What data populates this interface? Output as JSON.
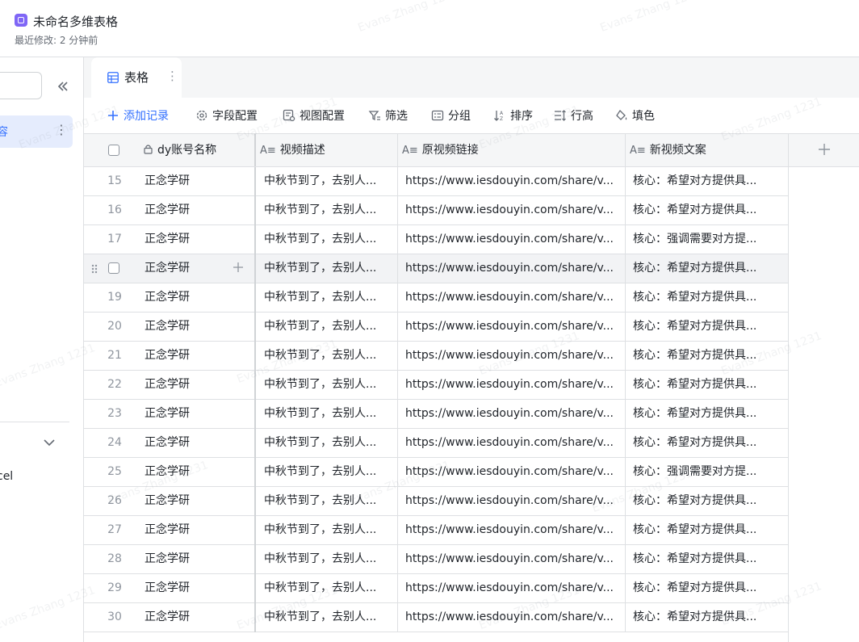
{
  "header": {
    "title": "未命名多维表格",
    "subtitle": "最近修改: 2 分钟前"
  },
  "sidebar": {
    "active_item_label": "容",
    "more_icon": "⋮",
    "section_item_label": "cel"
  },
  "tabs": [
    {
      "label": "表格",
      "more": "⋮"
    }
  ],
  "toolbar": {
    "add_record": "添加记录",
    "field_config": "字段配置",
    "view_config": "视图配置",
    "filter": "筛选",
    "group": "分组",
    "sort": "排序",
    "row_height": "行高",
    "fill_color": "填色"
  },
  "table": {
    "columns": [
      "dy账号名称",
      "视频描述",
      "原视频链接",
      "新视频文案"
    ],
    "rows": [
      {
        "num": "15",
        "account": "正念学研",
        "desc": "中秋节到了，去别人...",
        "link": "https://www.iesdouyin.com/share/v...",
        "copy": "核心：希望对方提供具..."
      },
      {
        "num": "16",
        "account": "正念学研",
        "desc": "中秋节到了，去别人...",
        "link": "https://www.iesdouyin.com/share/v...",
        "copy": "核心：希望对方提供具..."
      },
      {
        "num": "17",
        "account": "正念学研",
        "desc": "中秋节到了，去别人...",
        "link": "https://www.iesdouyin.com/share/v...",
        "copy": "核心：强调需要对方提..."
      },
      {
        "num": "",
        "account": "正念学研",
        "desc": "中秋节到了，去别人...",
        "link": "https://www.iesdouyin.com/share/v...",
        "copy": "核心：希望对方提供具..."
      },
      {
        "num": "19",
        "account": "正念学研",
        "desc": "中秋节到了，去别人...",
        "link": "https://www.iesdouyin.com/share/v...",
        "copy": "核心：希望对方提供具..."
      },
      {
        "num": "20",
        "account": "正念学研",
        "desc": "中秋节到了，去别人...",
        "link": "https://www.iesdouyin.com/share/v...",
        "copy": "核心：希望对方提供具..."
      },
      {
        "num": "21",
        "account": "正念学研",
        "desc": "中秋节到了，去别人...",
        "link": "https://www.iesdouyin.com/share/v...",
        "copy": "核心：希望对方提供具..."
      },
      {
        "num": "22",
        "account": "正念学研",
        "desc": "中秋节到了，去别人...",
        "link": "https://www.iesdouyin.com/share/v...",
        "copy": "核心：希望对方提供具..."
      },
      {
        "num": "23",
        "account": "正念学研",
        "desc": "中秋节到了，去别人...",
        "link": "https://www.iesdouyin.com/share/v...",
        "copy": "核心：希望对方提供具..."
      },
      {
        "num": "24",
        "account": "正念学研",
        "desc": "中秋节到了，去别人...",
        "link": "https://www.iesdouyin.com/share/v...",
        "copy": "核心：希望对方提供具..."
      },
      {
        "num": "25",
        "account": "正念学研",
        "desc": "中秋节到了，去别人...",
        "link": "https://www.iesdouyin.com/share/v...",
        "copy": "核心：强调需要对方提..."
      },
      {
        "num": "26",
        "account": "正念学研",
        "desc": "中秋节到了，去别人...",
        "link": "https://www.iesdouyin.com/share/v...",
        "copy": "核心：希望对方提供具..."
      },
      {
        "num": "27",
        "account": "正念学研",
        "desc": "中秋节到了，去别人...",
        "link": "https://www.iesdouyin.com/share/v...",
        "copy": "核心：希望对方提供具..."
      },
      {
        "num": "28",
        "account": "正念学研",
        "desc": "中秋节到了，去别人...",
        "link": "https://www.iesdouyin.com/share/v...",
        "copy": "核心：希望对方提供具..."
      },
      {
        "num": "29",
        "account": "正念学研",
        "desc": "中秋节到了，去别人...",
        "link": "https://www.iesdouyin.com/share/v...",
        "copy": "核心：希望对方提供具..."
      },
      {
        "num": "30",
        "account": "正念学研",
        "desc": "中秋节到了，去别人...",
        "link": "https://www.iesdouyin.com/share/v...",
        "copy": "核心：希望对方提供具..."
      }
    ],
    "hovered_row_index": 3
  },
  "watermark": "Evans Zhang 1231",
  "colors": {
    "accent": "#3370ff",
    "app_icon": "#7f66f6",
    "border": "#dee0e3",
    "header_bg": "#f5f6f7"
  },
  "icons": {
    "add": "plus-icon",
    "field_config": "gear-icon",
    "view_config": "view-config-icon",
    "filter": "filter-icon",
    "group": "group-icon",
    "sort": "sort-icon",
    "row_height": "row-height-icon",
    "fill_color": "paint-bucket-icon",
    "primary_field": "lock-icon",
    "text_field": "text-field-icon",
    "add_column": "plus-icon"
  }
}
